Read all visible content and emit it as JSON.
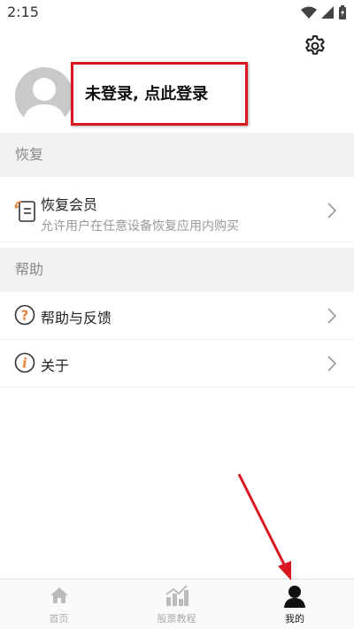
{
  "status_bar": {
    "time": "2:15"
  },
  "profile": {
    "login_prompt": "未登录, 点此登录"
  },
  "sections": {
    "restore": {
      "header": "恢复",
      "item": {
        "title": "恢复会员",
        "subtitle": "允许用户在任意设备恢复应用内购买"
      }
    },
    "help": {
      "header": "帮助",
      "items": [
        {
          "title": "帮助与反馈"
        },
        {
          "title": "关于"
        }
      ]
    }
  },
  "tabbar": {
    "tabs": [
      {
        "label": "首页"
      },
      {
        "label": "股票教程"
      },
      {
        "label": "我的"
      }
    ]
  },
  "colors": {
    "annotation_red": "#d9181f",
    "icon_orange": "#e8823a"
  },
  "icons": [
    "wifi-icon",
    "signal-icon",
    "battery-icon",
    "gear-icon",
    "avatar-icon",
    "restore-icon",
    "help-icon",
    "info-icon",
    "chevron-right-icon",
    "home-icon",
    "chart-icon",
    "person-icon"
  ]
}
